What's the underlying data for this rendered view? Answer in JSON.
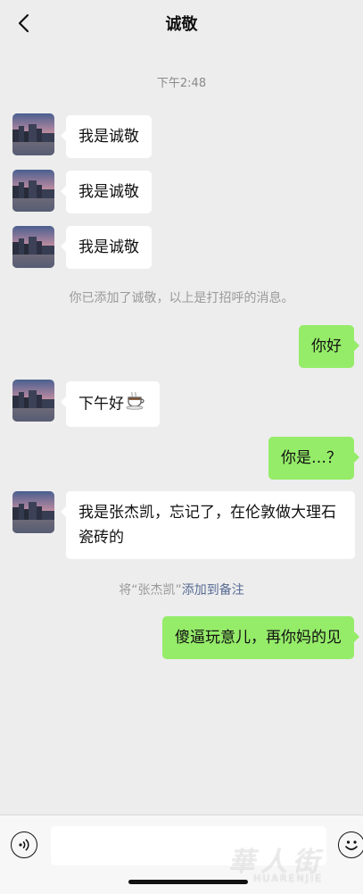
{
  "header": {
    "title": "诚敬"
  },
  "timestamp": "下午2:48",
  "messages": [
    {
      "text": "我是诚敬"
    },
    {
      "text": "我是诚敬"
    },
    {
      "text": "我是诚敬"
    },
    {
      "text": "你好"
    },
    {
      "text": "下午好"
    },
    {
      "text": "你是…？"
    },
    {
      "text": "我是张杰凯，忘记了，在伦敦做大理石瓷砖的"
    },
    {
      "text": "傻逼玩意儿，再你妈的见"
    }
  ],
  "system": {
    "added": "你已添加了诚敬，以上是打招呼的消息。",
    "remark_prefix": "将“张杰凯”",
    "remark_link": "添加到备注"
  },
  "watermark": {
    "cn": "華人街",
    "en": "HUARENJIE"
  },
  "colors": {
    "sent_bubble": "#95ec69",
    "received_bubble": "#ffffff",
    "link": "#576b95",
    "background": "#ededed"
  }
}
